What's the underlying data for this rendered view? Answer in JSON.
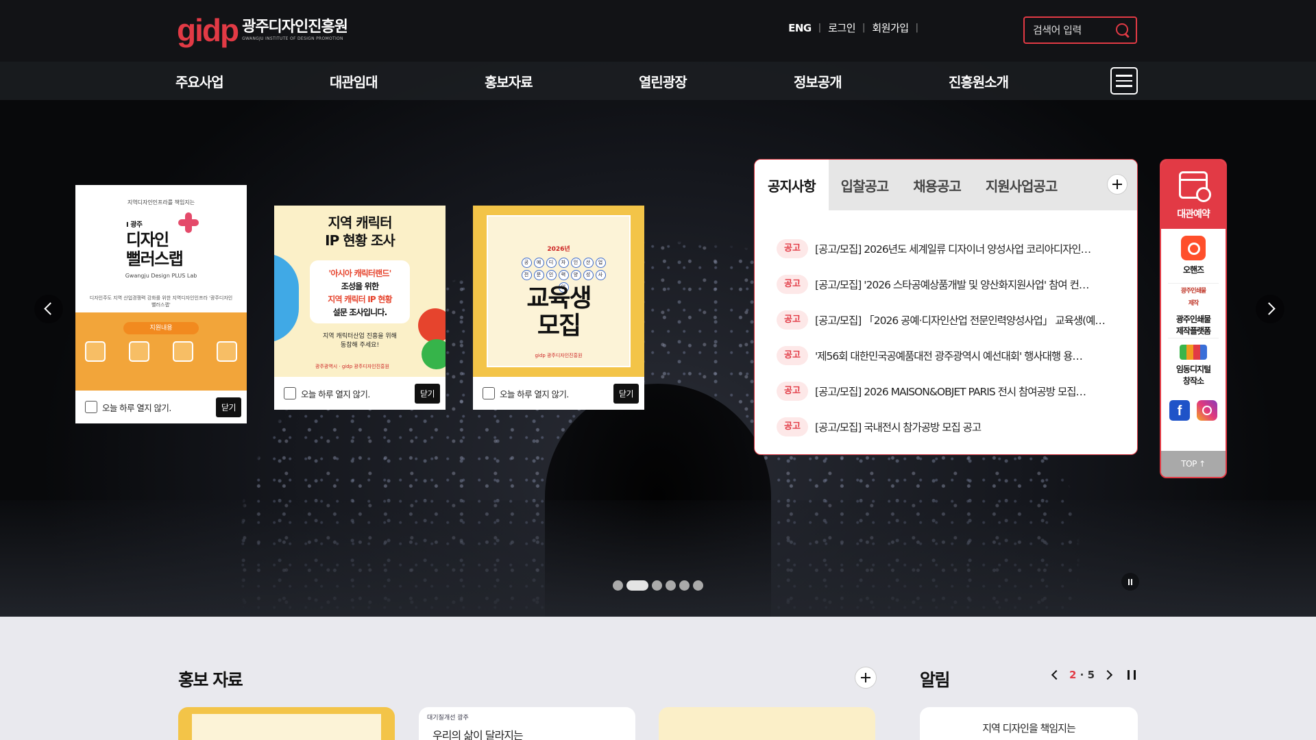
{
  "header": {
    "logo_mark": "gidp",
    "logo_name": "광주디자인진흥원",
    "logo_sub": "GWANGJU INSTITUTE OF DESIGN PROMOTION",
    "util": {
      "eng": "ENG",
      "login": "로그인",
      "join": "회원가입",
      "sep": "|"
    },
    "search_placeholder": "검색어 입력"
  },
  "gnb": [
    "주요사업",
    "대관임대",
    "홍보자료",
    "열린광장",
    "정보공개",
    "진흥원소개"
  ],
  "popups": {
    "p1": {
      "kick": "지역디자인인프라를 책임지는",
      "title_small": "I 광주",
      "title_l1": "디자인",
      "title_l2": "뻘러스랩",
      "en": "Gwangju Design PLUS Lab",
      "desc": "디자인주도 지역 산업경쟁력 강화를 위한 지역디자인인프라 '광주디자인뻘러스랩'",
      "pill": "지원내용",
      "foot": "오늘 하루 열지 않기.",
      "close": "닫기"
    },
    "p2": {
      "title_l1": "지역 캐릭터",
      "title_l2": "IP 현황 조사",
      "bubble_l1": "'아시아 캐릭터랜드'",
      "bubble_l2": "조성을 위한",
      "bubble_l3": "지역 캐릭터 IP 현황",
      "bubble_l4": "설문 조사입니다.",
      "sub_l1": "지역 캐릭터산업 진흥을 위해",
      "sub_l2": "동참해 주세요!",
      "logos": "광주광역시 · gidp 광주디자인진흥원",
      "foot": "오늘 하루 열지 않기.",
      "close": "닫기"
    },
    "p3": {
      "year": "2026년",
      "circles": [
        "공",
        "예",
        "디",
        "자",
        "인",
        "산",
        "업",
        "전",
        "문",
        "인",
        "력",
        "양",
        "성",
        "사",
        "업"
      ],
      "title_l1": "교육생",
      "title_l2": "모집",
      "logos": "gidp 광주디자인진흥원",
      "foot": "오늘 하루 열지 않기.",
      "close": "닫기"
    }
  },
  "notice": {
    "tabs": [
      "공지사항",
      "입찰공고",
      "채용공고",
      "지원사업공고"
    ],
    "badge": "공고",
    "items": [
      "[공고/모집] 2026년도 세계일류 디자이너 양성사업 코리아디자인…",
      "[공고/모집] '2026 스타공예상품개발 및 양산화지원사업' 참여 컨…",
      "[공고/모집] 「2026 공예·디자인산업 전문인력양성사업」 교육생(예…",
      "'제56회 대한민국공예품대전 광주광역시 예선대회' 행사대행 용…",
      "[공고/모집] 2026 MAISON&OBJET PARIS 전시 참여공방 모집…",
      "[공고/모집] 국내전시 참가공방 모집 공고"
    ]
  },
  "quick": {
    "reserve": "대관예약",
    "ohands": "오핸즈",
    "print_icon_text": "광주인쇄물 제작",
    "print": "광주인쇄물\n제작플랫폼",
    "digital": "임동디지털\n창작소",
    "top": "TOP ↑"
  },
  "slider": {
    "dots": 6,
    "active": 1
  },
  "bottom": {
    "promo_title": "홍보 자료",
    "notify_title": "알림",
    "pager_current": "2",
    "pager_total": "5",
    "card2_kicker": "대기질개선 광주",
    "card2_text": "우리의 삶이 달라지는",
    "card4_text": "지역 디자인을 책임지는"
  },
  "colors": {
    "accent": "#e23a45",
    "header_bg": "#121316"
  }
}
